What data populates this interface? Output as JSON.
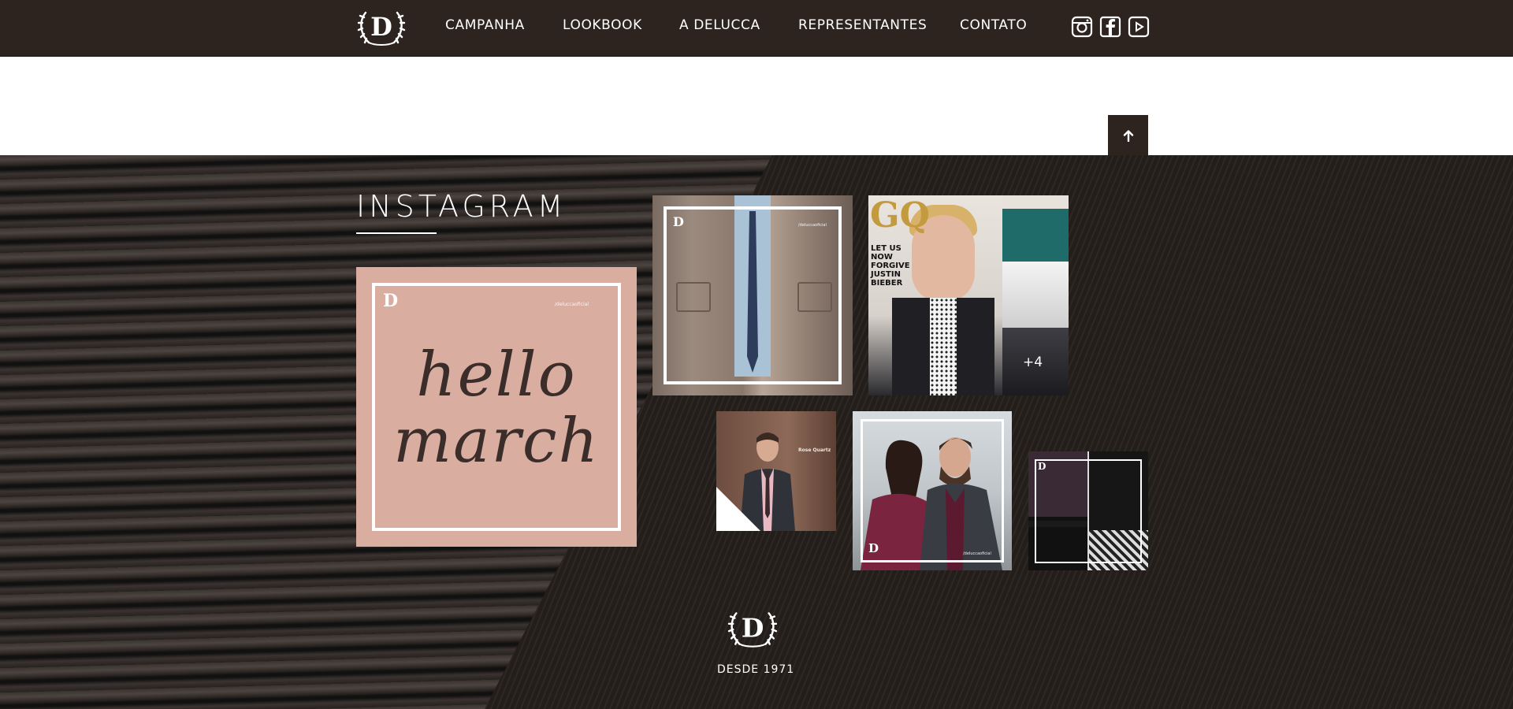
{
  "nav": {
    "logo_letter": "D",
    "items": [
      {
        "label": "CAMPANHA"
      },
      {
        "label": "LOOKBOOK"
      },
      {
        "label": "A DELUCCA"
      },
      {
        "label": "REPRESENTANTES"
      },
      {
        "label": "CONTATO"
      }
    ],
    "social": [
      "instagram-icon",
      "facebook-icon",
      "youtube-icon"
    ]
  },
  "back_to_top": {
    "icon": "arrow-up-icon"
  },
  "instagram": {
    "title": "INSTAGRAM",
    "posts": [
      {
        "id": "hello-march",
        "text_line1": "hello",
        "text_line2": "march",
        "logo": "D",
        "handle": "/deluccaoficial"
      },
      {
        "id": "jacket-tie",
        "logo": "D",
        "handle": "/deluccaoficial"
      },
      {
        "id": "gq-cover",
        "magazine": "GQ",
        "headline_lines": [
          "LET US",
          "NOW",
          "FORGIVE",
          "JUSTIN",
          "BIEBER"
        ],
        "more_count": "+4"
      },
      {
        "id": "rose-quartz",
        "caption": "Rose Quartz"
      },
      {
        "id": "couple",
        "logo": "D",
        "handle": "/deluccaoficial"
      },
      {
        "id": "shirts",
        "logo": "D"
      }
    ]
  },
  "footer": {
    "logo_letter": "D",
    "since": "DESDE 1971"
  },
  "colors": {
    "nav_bg": "#2d241f",
    "section_bg": "#241e1b",
    "text": "#ffffff",
    "pink_post": "#d9ada0"
  }
}
